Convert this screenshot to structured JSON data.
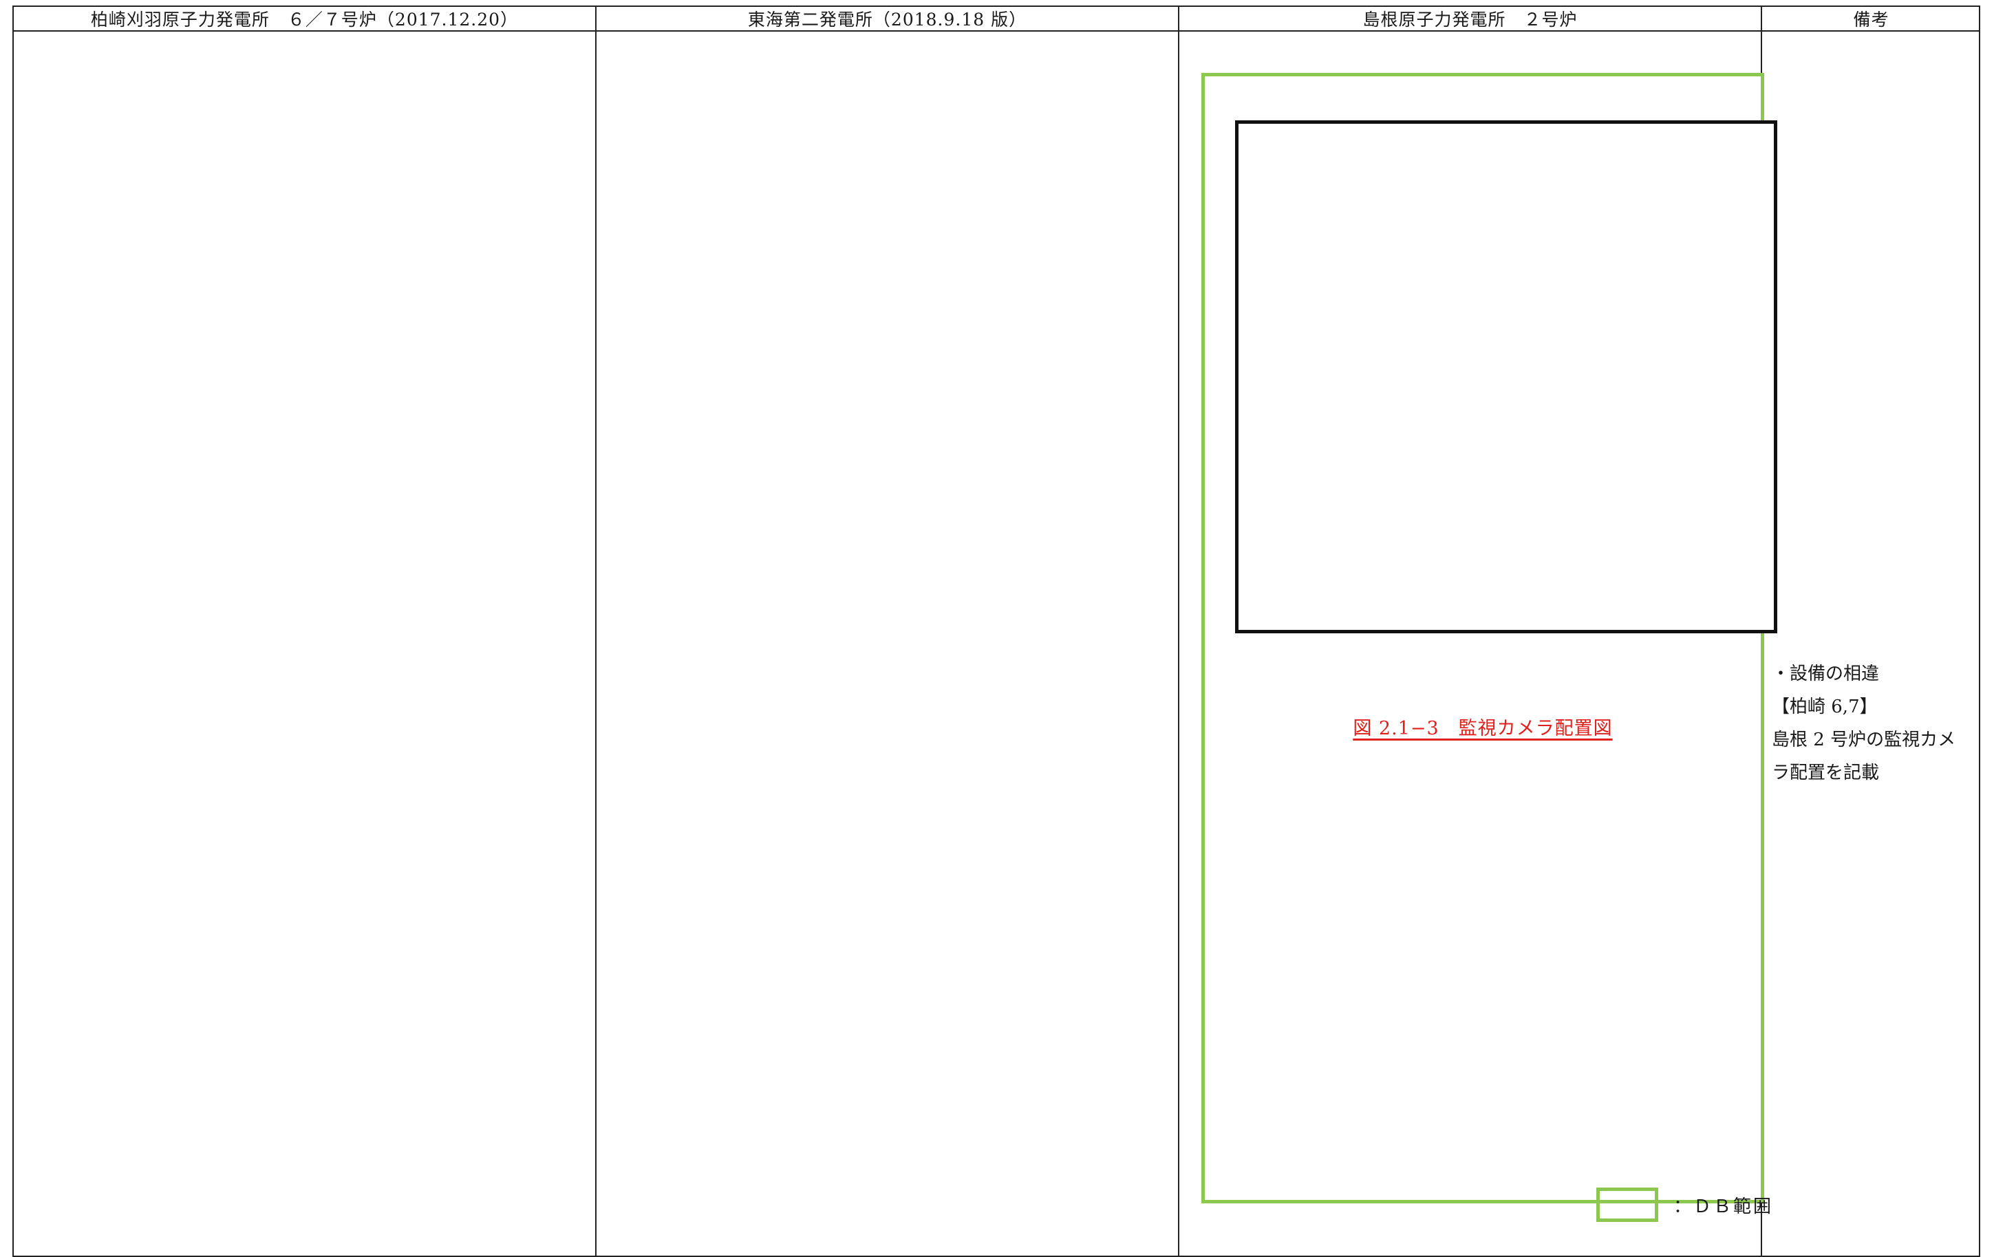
{
  "columns": {
    "kashiwazaki": {
      "header": "柏崎刈羽原子力発電所　６／７号炉（2017.12.20）"
    },
    "tokai": {
      "header": "東海第二発電所（2018.9.18 版）"
    },
    "shimane": {
      "header": "島根原子力発電所　２号炉",
      "figure_caption": "図 2.1−3　監視カメラ配置図",
      "legend_label": "：ＤＢ範囲"
    },
    "remarks": {
      "header": "備考",
      "lines": [
        "・設備の相違",
        "【柏崎 6,7】",
        "島根 2 号炉の監視カメ",
        "ラ配置を記載"
      ]
    }
  },
  "colors": {
    "db_range_frame": "#8cc850",
    "caption_text": "#e0201c",
    "rule_lines": "#222222"
  }
}
